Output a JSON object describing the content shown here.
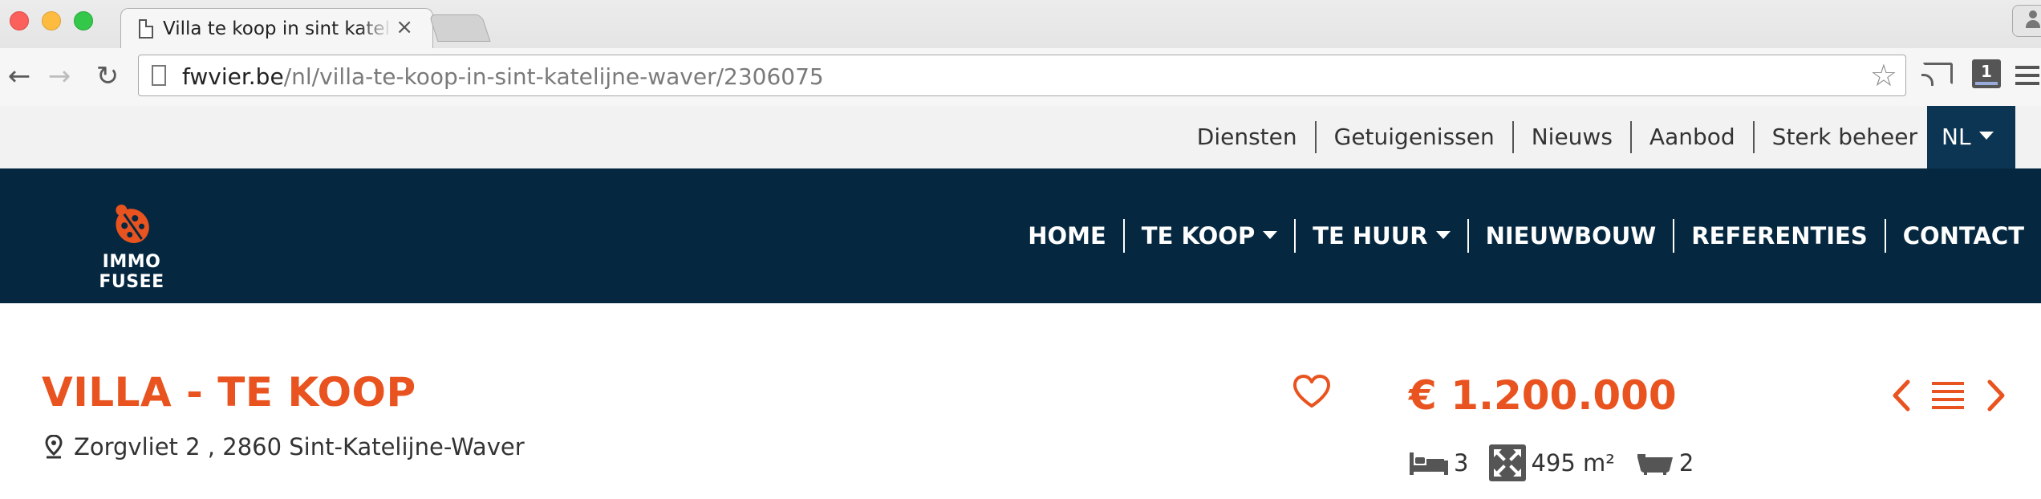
{
  "browser": {
    "tab_title": "Villa te koop in sint katelijne-waver",
    "tab_close": "×",
    "url_host": "fwvier.be",
    "url_path": "/nl/villa-te-koop-in-sint-katelijne-waver/2306075",
    "extension_badge": "1"
  },
  "utility_nav": {
    "links": [
      "Diensten",
      "Getuigenissen",
      "Nieuws",
      "Aanbod",
      "Sterk beheer"
    ],
    "language": "NL"
  },
  "main_nav": {
    "logo_text": "IMMO FUSEE",
    "items": [
      "HOME",
      "TE KOOP",
      "TE HUUR",
      "NIEUWBOUW",
      "REFERENTIES",
      "CONTACT"
    ]
  },
  "listing": {
    "title": "VILLA - TE KOOP",
    "address": "Zorgvliet 2 , 2860 Sint-Katelijne-Waver",
    "price": "€ 1.200.000",
    "bedrooms": "3",
    "area": "495 m²",
    "bathrooms": "2"
  },
  "colors": {
    "accent": "#e9531f",
    "navy": "#052840",
    "lang_bg": "#0c3554",
    "utility_bg": "#f2f2f2"
  },
  "icons": {
    "favorite": "heart-icon",
    "previous": "chevron-left-icon",
    "overview": "list-icon",
    "next": "chevron-right-icon",
    "location": "map-pin-icon",
    "bedrooms": "bed-icon",
    "area": "expand-icon",
    "bathrooms": "bathtub-icon"
  }
}
